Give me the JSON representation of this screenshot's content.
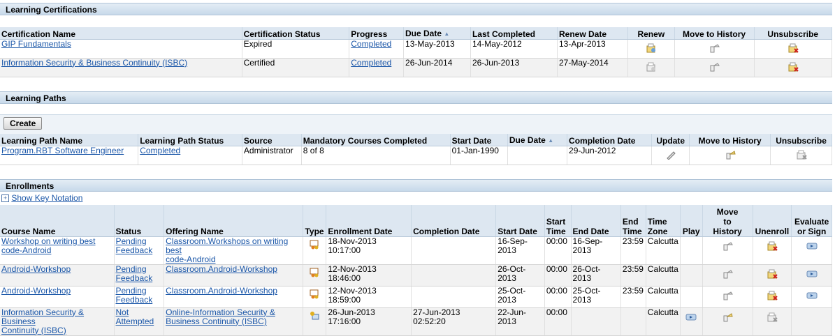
{
  "certifications": {
    "title": "Learning Certifications",
    "columns": [
      "Certification Name",
      "Certification Status",
      "Progress",
      "Due Date",
      "Last Completed",
      "Renew Date",
      "Renew",
      "Move to History",
      "Unsubscribe"
    ],
    "rows": [
      {
        "name": "GIP Fundamentals",
        "status": "Expired",
        "progress": "Completed",
        "due": "13-May-2013",
        "last": "14-May-2012",
        "renew_date": "13-Apr-2013"
      },
      {
        "name": "Information Security & Business Continuity (ISBC)",
        "status": "Certified",
        "progress": "Completed",
        "due": "26-Jun-2014",
        "last": "26-Jun-2013",
        "renew_date": "27-May-2014"
      }
    ]
  },
  "paths": {
    "title": "Learning Paths",
    "create_label": "Create",
    "columns": [
      "Learning Path Name",
      "Learning Path Status",
      "Source",
      "Mandatory Courses Completed",
      "Start Date",
      "Due Date",
      "Completion Date",
      "Update",
      "Move to History",
      "Unsubscribe"
    ],
    "rows": [
      {
        "name": "Program.RBT Software Engineer",
        "status": "Completed",
        "source": "Administrator",
        "mandatory": "8 of 8",
        "start": "01-Jan-1990",
        "due": "",
        "completion": "29-Jun-2012"
      }
    ]
  },
  "enrollments": {
    "title": "Enrollments",
    "key_notation": "Show Key Notation",
    "columns": {
      "course": "Course Name",
      "status": "Status",
      "offering": "Offering Name",
      "type": "Type",
      "enroll": "Enrollment Date",
      "completion": "Completion Date",
      "start_date": "Start Date",
      "start_time_1": "Start",
      "start_time_2": "Time",
      "end_date": "End Date",
      "end_time_1": "End",
      "end_time_2": "Time",
      "tz_1": "Time",
      "tz_2": "Zone",
      "play": "Play",
      "move_1": "Move",
      "move_2": "to",
      "move_3": "History",
      "unenroll": "Unenroll",
      "eval_1": "Evaluate",
      "eval_2": "or Sign"
    },
    "rows": [
      {
        "course": [
          "Workshop on writing best",
          "code-Android"
        ],
        "status": [
          "Pending",
          "Feedback"
        ],
        "offering": [
          "Classroom.Workshops on writing best",
          "code-Android"
        ],
        "type": "classroom",
        "enroll": "18-Nov-2013 10:17:00",
        "completion": "",
        "start_date": "16-Sep-2013",
        "start_time": "00:00",
        "end_date": "16-Sep-2013",
        "end_time": "23:59",
        "tz": "Calcutta"
      },
      {
        "course": [
          "Android-Workshop"
        ],
        "status": [
          "Pending",
          "Feedback"
        ],
        "offering": [
          "Classroom.Android-Workshop"
        ],
        "type": "classroom",
        "enroll": "12-Nov-2013 18:46:00",
        "completion": "",
        "start_date": "26-Oct-2013",
        "start_time": "00:00",
        "end_date": "26-Oct-2013",
        "end_time": "23:59",
        "tz": "Calcutta"
      },
      {
        "course": [
          "Android-Workshop"
        ],
        "status": [
          "Pending",
          "Feedback"
        ],
        "offering": [
          "Classroom.Android-Workshop"
        ],
        "type": "classroom",
        "enroll": "12-Nov-2013 18:59:00",
        "completion": "",
        "start_date": "25-Oct-2013",
        "start_time": "00:00",
        "end_date": "25-Oct-2013",
        "end_time": "23:59",
        "tz": "Calcutta"
      },
      {
        "course": [
          "Information Security & Business",
          "Continuity (ISBC)"
        ],
        "status": [
          "Not",
          "Attempted"
        ],
        "offering": [
          "Online-Information Security &",
          "Business Continuity (ISBC)"
        ],
        "type": "online",
        "enroll": "26-Jun-2013 17:16:00",
        "completion": "27-Jun-2013 02:52:20",
        "start_date": "22-Jun-2013",
        "start_time": "00:00",
        "end_date": "",
        "end_time": "",
        "tz": "Calcutta"
      }
    ]
  }
}
